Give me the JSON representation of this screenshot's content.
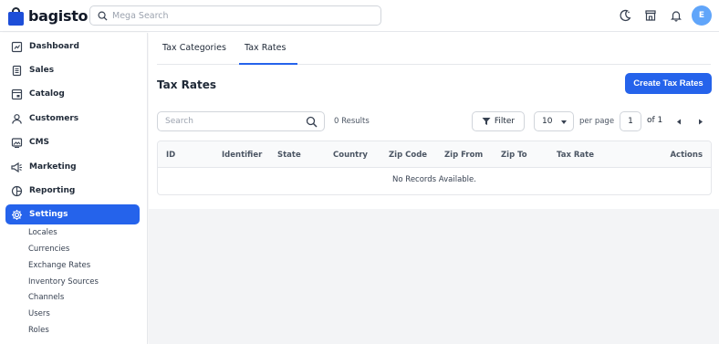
{
  "header": {
    "brand": "bagisto",
    "search_placeholder": "Mega Search",
    "avatar_initial": "E"
  },
  "sidebar": {
    "items": [
      {
        "label": "Dashboard",
        "icon": "dashboard-icon"
      },
      {
        "label": "Sales",
        "icon": "sales-icon"
      },
      {
        "label": "Catalog",
        "icon": "catalog-icon"
      },
      {
        "label": "Customers",
        "icon": "customers-icon"
      },
      {
        "label": "CMS",
        "icon": "cms-icon"
      },
      {
        "label": "Marketing",
        "icon": "marketing-icon"
      },
      {
        "label": "Reporting",
        "icon": "reporting-icon"
      },
      {
        "label": "Settings",
        "icon": "settings-icon",
        "active": true
      }
    ],
    "settings_children": [
      "Locales",
      "Currencies",
      "Exchange Rates",
      "Inventory Sources",
      "Channels",
      "Users",
      "Roles"
    ]
  },
  "tabs": [
    {
      "label": "Tax Categories"
    },
    {
      "label": "Tax Rates",
      "active": true
    }
  ],
  "page": {
    "title": "Tax Rates",
    "create_button": "Create Tax Rates"
  },
  "datagrid": {
    "search_placeholder": "Search",
    "results": "0 Results",
    "filter_label": "Filter",
    "per_page_value": "10",
    "per_page_label": "per page",
    "current_page": "1",
    "of_label": "of 1",
    "columns": [
      "ID",
      "Identifier",
      "State",
      "Country",
      "Zip Code",
      "Zip From",
      "Zip To",
      "Tax Rate",
      "Actions"
    ],
    "empty_message": "No Records Available."
  },
  "colors": {
    "accent": "#2563eb",
    "avatar": "#60a5fa"
  }
}
